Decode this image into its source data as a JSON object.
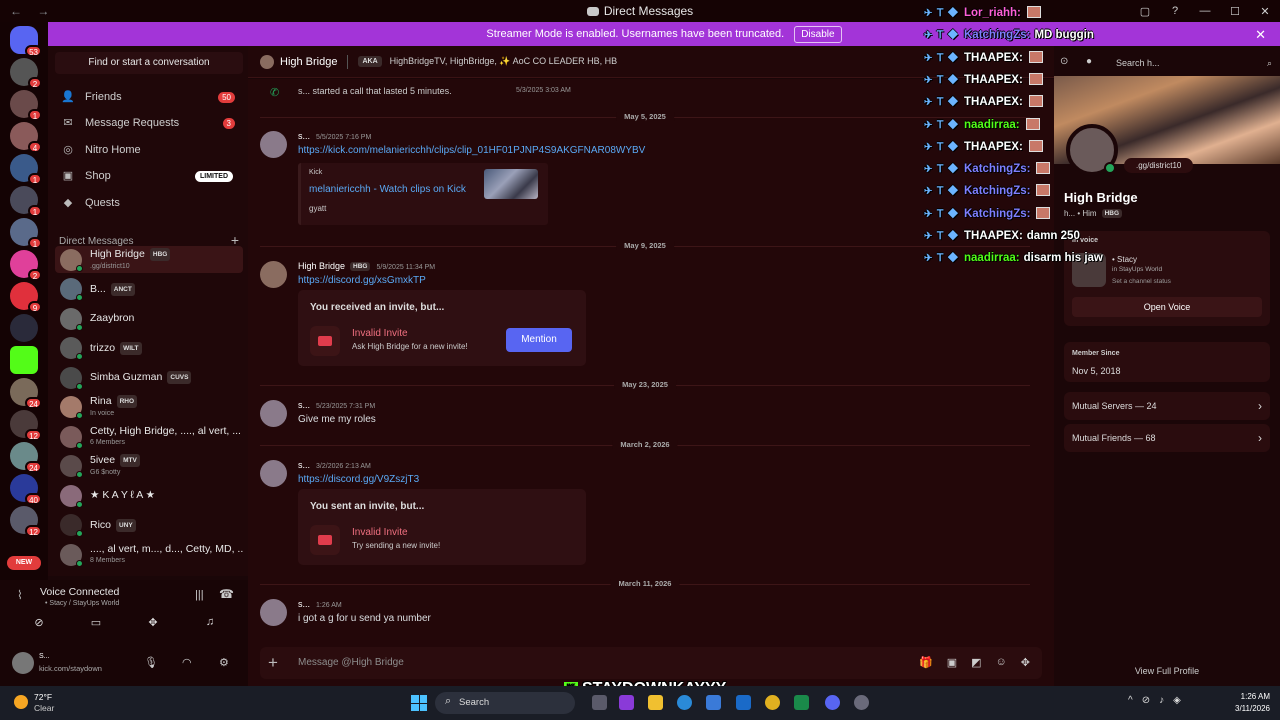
{
  "window": {
    "title": "Direct Messages",
    "nav": "← →",
    "controls": [
      "▢",
      "?",
      "—",
      "☐",
      "✕"
    ]
  },
  "banner": {
    "text": "Streamer Mode is enabled. Usernames have been truncated.",
    "button": "Disable",
    "close": "✕"
  },
  "rail": {
    "badges": [
      "53",
      "2",
      "1",
      "4",
      "1",
      "1",
      "1",
      "2",
      "9",
      "24",
      "12",
      "24",
      "40",
      "12"
    ],
    "new_label": "NEW"
  },
  "sidebar": {
    "find_placeholder": "Find or start a conversation",
    "nav": [
      {
        "label": "Friends",
        "icon": "friends-icon",
        "count": "50"
      },
      {
        "label": "Message Requests",
        "icon": "mail-icon",
        "count": "3"
      },
      {
        "label": "Nitro Home",
        "icon": "nitro-icon",
        "count": ""
      },
      {
        "label": "Shop",
        "icon": "shop-icon",
        "badge": "LIMITED"
      },
      {
        "label": "Quests",
        "icon": "quests-icon",
        "count": ""
      }
    ],
    "dm_header": "Direct Messages",
    "dms": [
      {
        "name": "High Bridge",
        "tag": "HBG",
        "sub": ".gg/district10",
        "color": "#8a6c60"
      },
      {
        "name": "B...",
        "tag": "ANCT",
        "sub": "",
        "color": "#5a6a7a"
      },
      {
        "name": "Zaaybron",
        "tag": "",
        "sub": "",
        "color": "#6a6a6a"
      },
      {
        "name": "trizzo",
        "tag": "WILT",
        "sub": "",
        "color": "#5a5a5a"
      },
      {
        "name": "Simba Guzman",
        "tag": "CUVS",
        "sub": "",
        "color": "#4a4a4a"
      },
      {
        "name": "Rina",
        "tag": "RHO",
        "sub": "In voice",
        "color": "#a47a6a"
      },
      {
        "name": "Cetty, High Bridge, ...., al vert, ...",
        "tag": "",
        "sub": "6 Members",
        "color": "#7a5a5a"
      },
      {
        "name": "5ivee",
        "tag": "MTV",
        "sub": "G6 $notty",
        "color": "#5a4a4a"
      },
      {
        "name": "★ K A Y ℓ A ★",
        "tag": "",
        "sub": "",
        "color": "#8a6a7a"
      },
      {
        "name": "Rico",
        "tag": "UNY",
        "sub": "",
        "color": "#3a2a2a"
      },
      {
        "name": "...., al vert, m..., d..., Cetty, MD, ...",
        "tag": "",
        "sub": "8 Members",
        "color": "#6a5a5a"
      }
    ]
  },
  "voice": {
    "title": "Voice Connected",
    "sub": "• Stacy / StayUps World"
  },
  "user": {
    "name": "S...",
    "status": "kick.com/staydown"
  },
  "chat": {
    "header_name": "High Bridge",
    "aka_label": "AKA",
    "aka": "HighBridgeTV, HighBridge, ✨ AoC CO LEADER HB, HB",
    "call_text": "s... started a call that lasted 5 minutes.",
    "call_time": "5/3/2025 3:03 AM",
    "dividers": [
      "May 5, 2025",
      "May 9, 2025",
      "May 23, 2025",
      "March 2, 2026",
      "March 11, 2026"
    ],
    "messages": [
      {
        "author": "s...",
        "time": "5/5/2025 7:16 PM",
        "body": "https://kick.com/melaniericchh/clips/clip_01HF01PJNP4S9AKGFNAR08WYBV"
      },
      {
        "author": "High Bridge",
        "tag": "HBG",
        "time": "5/9/2025 11:34 PM",
        "body": "https://discord.gg/xsGmxkTP"
      },
      {
        "author": "s...",
        "time": "5/23/2025 7:31 PM",
        "body": "Give me my roles"
      },
      {
        "author": "s...",
        "time": "3/2/2026 2:13 AM",
        "body": "https://discord.gg/V9ZszjT3"
      },
      {
        "author": "s...",
        "time": "1:26 AM",
        "body": "i got a g for u send ya number"
      }
    ],
    "embed": {
      "provider": "Kick",
      "title": "melaniericchh - Watch clips on Kick",
      "desc": "gyatt"
    },
    "invite_received": {
      "header": "You received an invite, but...",
      "title": "Invalid Invite",
      "sub": "Ask High Bridge for a new invite!",
      "button": "Mention"
    },
    "invite_sent": {
      "header": "You sent an invite, but...",
      "title": "Invalid Invite",
      "sub": "Try sending a new invite!"
    },
    "composer_placeholder": "Message @High Bridge"
  },
  "profile": {
    "search": "Search h...",
    "status": ".gg/district10",
    "name": "High Bridge",
    "pronouns": "h... • Him",
    "tag": "HBG",
    "in_voice_label": "In voice",
    "voice_channel": "• Stacy",
    "voice_server": "in StayUps World",
    "channel_status": "Set a channel status",
    "open_voice": "Open Voice",
    "member_since_label": "Member Since",
    "member_since": "Nov 5, 2018",
    "mutual_servers": "Mutual Servers — 24",
    "mutual_friends": "Mutual Friends — 68",
    "view_full": "View Full Profile"
  },
  "overlay": [
    {
      "user": "Lor_riahh:",
      "text": "",
      "color": "#ff5fd7"
    },
    {
      "user": "KatchingZs:",
      "text": "MD buggin",
      "color": "#7f7fff"
    },
    {
      "user": "THAAPEX:",
      "text": "",
      "color": "#ffffff"
    },
    {
      "user": "THAAPEX:",
      "text": "",
      "color": "#ffffff"
    },
    {
      "user": "THAAPEX:",
      "text": "",
      "color": "#ffffff"
    },
    {
      "user": "naadirraa:",
      "text": "",
      "color": "#53fc18"
    },
    {
      "user": "THAAPEX:",
      "text": "",
      "color": "#ffffff"
    },
    {
      "user": "KatchingZs:",
      "text": "",
      "color": "#7f7fff"
    },
    {
      "user": "KatchingZs:",
      "text": "",
      "color": "#7f7fff"
    },
    {
      "user": "KatchingZs:",
      "text": "",
      "color": "#7f7fff"
    },
    {
      "user": "THAAPEX:",
      "text": "damn 250",
      "color": "#ffffff"
    },
    {
      "user": "naadirraa:",
      "text": "disarm his jaw",
      "color": "#53fc18"
    }
  ],
  "watermark": "STAYDOWNKAYYY",
  "taskbar": {
    "temp": "72°F",
    "condition": "Clear",
    "search": "Search",
    "time": "1:26 AM",
    "date": "3/11/2026"
  }
}
